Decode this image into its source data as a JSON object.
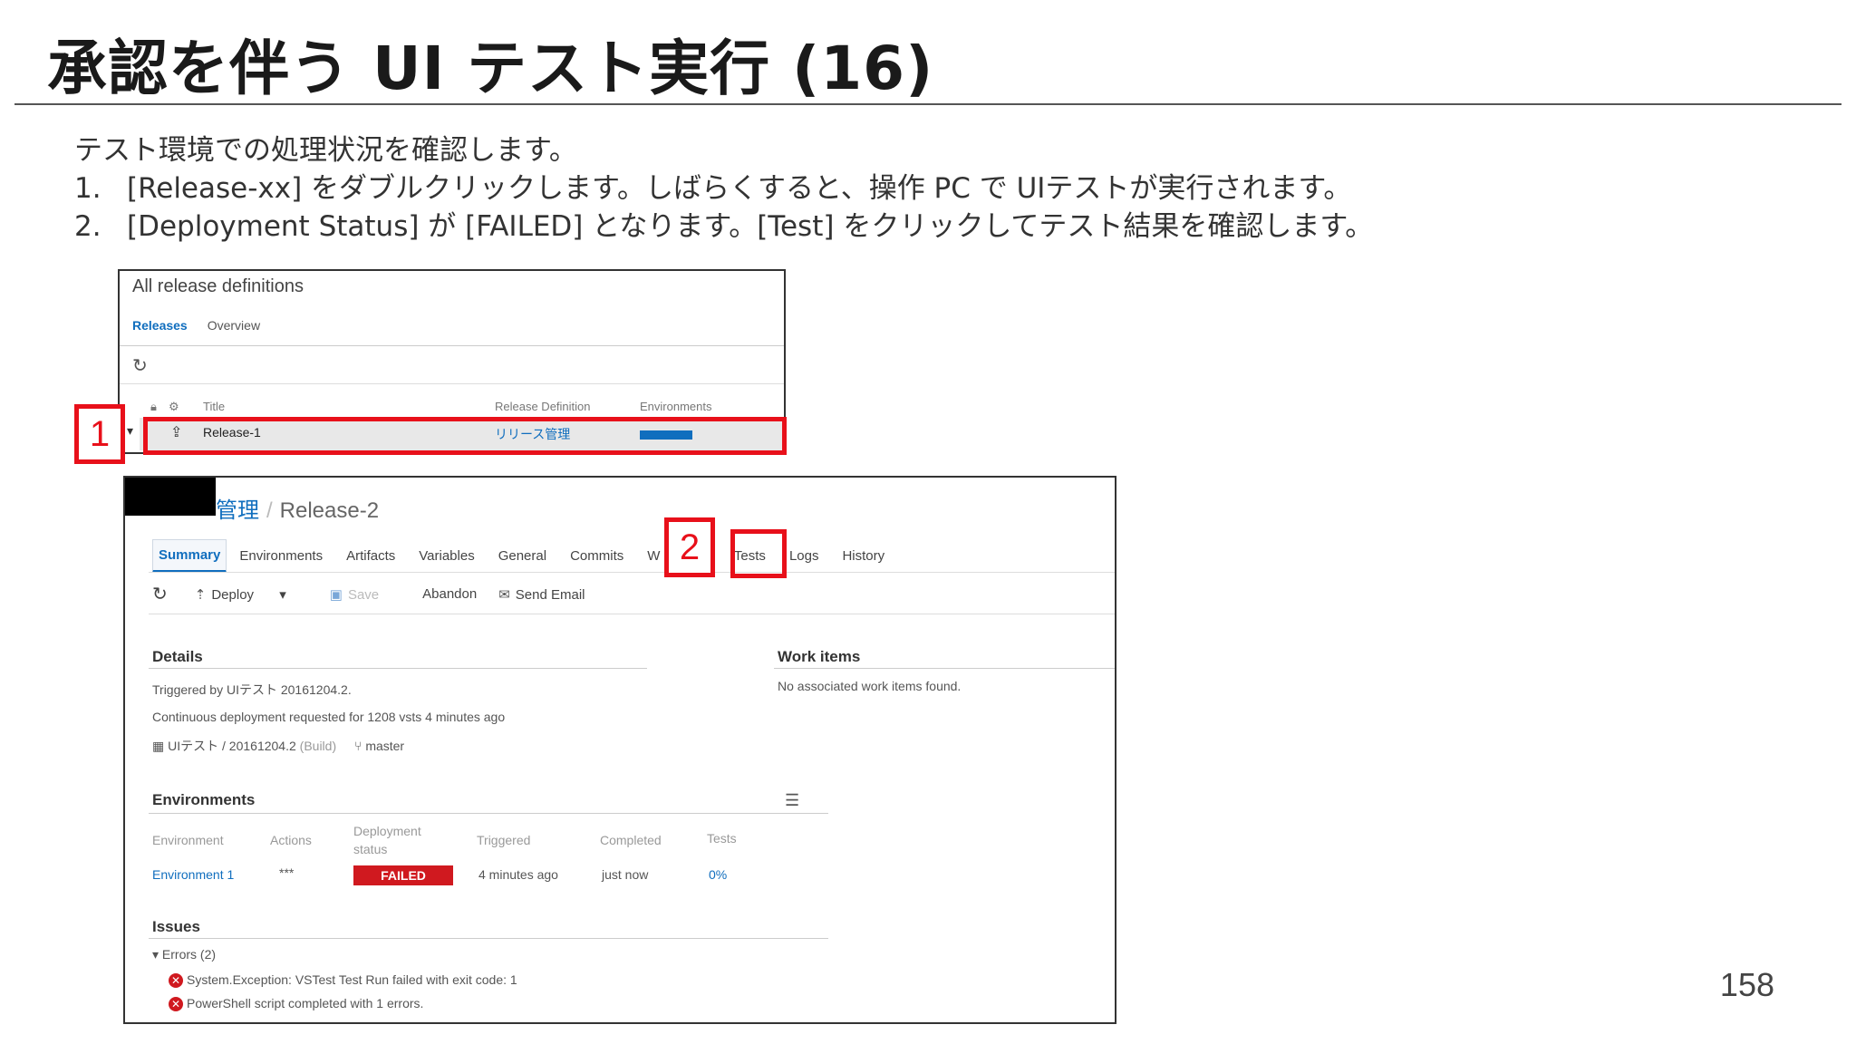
{
  "slide": {
    "title": "承認を伴う UI テスト実行 (16)",
    "intro": "テスト環境での処理状況を確認します。",
    "steps": [
      {
        "num": "1.",
        "text": "[Release-xx] をダブルクリックします。しばらくすると、操作 PC で UIテストが実行されます。"
      },
      {
        "num": "2.",
        "text": "[Deployment Status] が [FAILED]  となります。[Test] をクリックしてテスト結果を確認します。"
      }
    ],
    "page_number": "158"
  },
  "callouts": {
    "one": "1",
    "two": "2"
  },
  "release_list": {
    "header": "All release definitions",
    "tabs": {
      "releases": "Releases",
      "overview": "Overview"
    },
    "columns": {
      "title": "Title",
      "definition": "Release Definition",
      "environments": "Environments"
    },
    "row": {
      "name": "Release-1",
      "definition": "リリース管理"
    },
    "icons": {
      "refresh": "refresh-icon",
      "lock": "lock-icon",
      "release": "release-icon"
    }
  },
  "release_detail": {
    "breadcrumb": {
      "definition": "管理",
      "release": "Release-2"
    },
    "tabs": {
      "summary": "Summary",
      "environments": "Environments",
      "artifacts": "Artifacts",
      "variables": "Variables",
      "general": "General",
      "commits": "Commits",
      "workitems_partial": "W",
      "workitems_tail": "s",
      "tests": "Tests",
      "logs": "Logs",
      "history": "History"
    },
    "toolbar": {
      "deploy": "Deploy",
      "save": "Save",
      "abandon": "Abandon",
      "send_email": "Send Email"
    },
    "details": {
      "title": "Details",
      "triggered_by": "Triggered by UIテスト 20161204.2.",
      "continuous": "Continuous deployment requested for 1208 vsts 4 minutes ago",
      "artifact": "UIテスト / 20161204.2",
      "artifact_type": "(Build)",
      "branch": "master"
    },
    "work_items": {
      "title": "Work items",
      "empty": "No associated work items found."
    },
    "environments": {
      "title": "Environments",
      "headers": {
        "environment": "Environment",
        "actions": "Actions",
        "deployment_status_1": "Deployment",
        "deployment_status_2": "status",
        "triggered": "Triggered",
        "completed": "Completed",
        "tests": "Tests"
      },
      "row": {
        "environment": "Environment 1",
        "actions": "***",
        "status": "FAILED",
        "triggered": "4 minutes ago",
        "completed": "just now",
        "tests": "0%"
      }
    },
    "issues": {
      "title": "Issues",
      "errors_label": "Errors (2)",
      "errors": [
        "System.Exception: VSTest Test Run failed with exit code: 1",
        "PowerShell script completed with 1 errors."
      ]
    }
  },
  "colors": {
    "accent": "#106ebe",
    "callout": "#e8101a",
    "failed": "#d0191f"
  }
}
